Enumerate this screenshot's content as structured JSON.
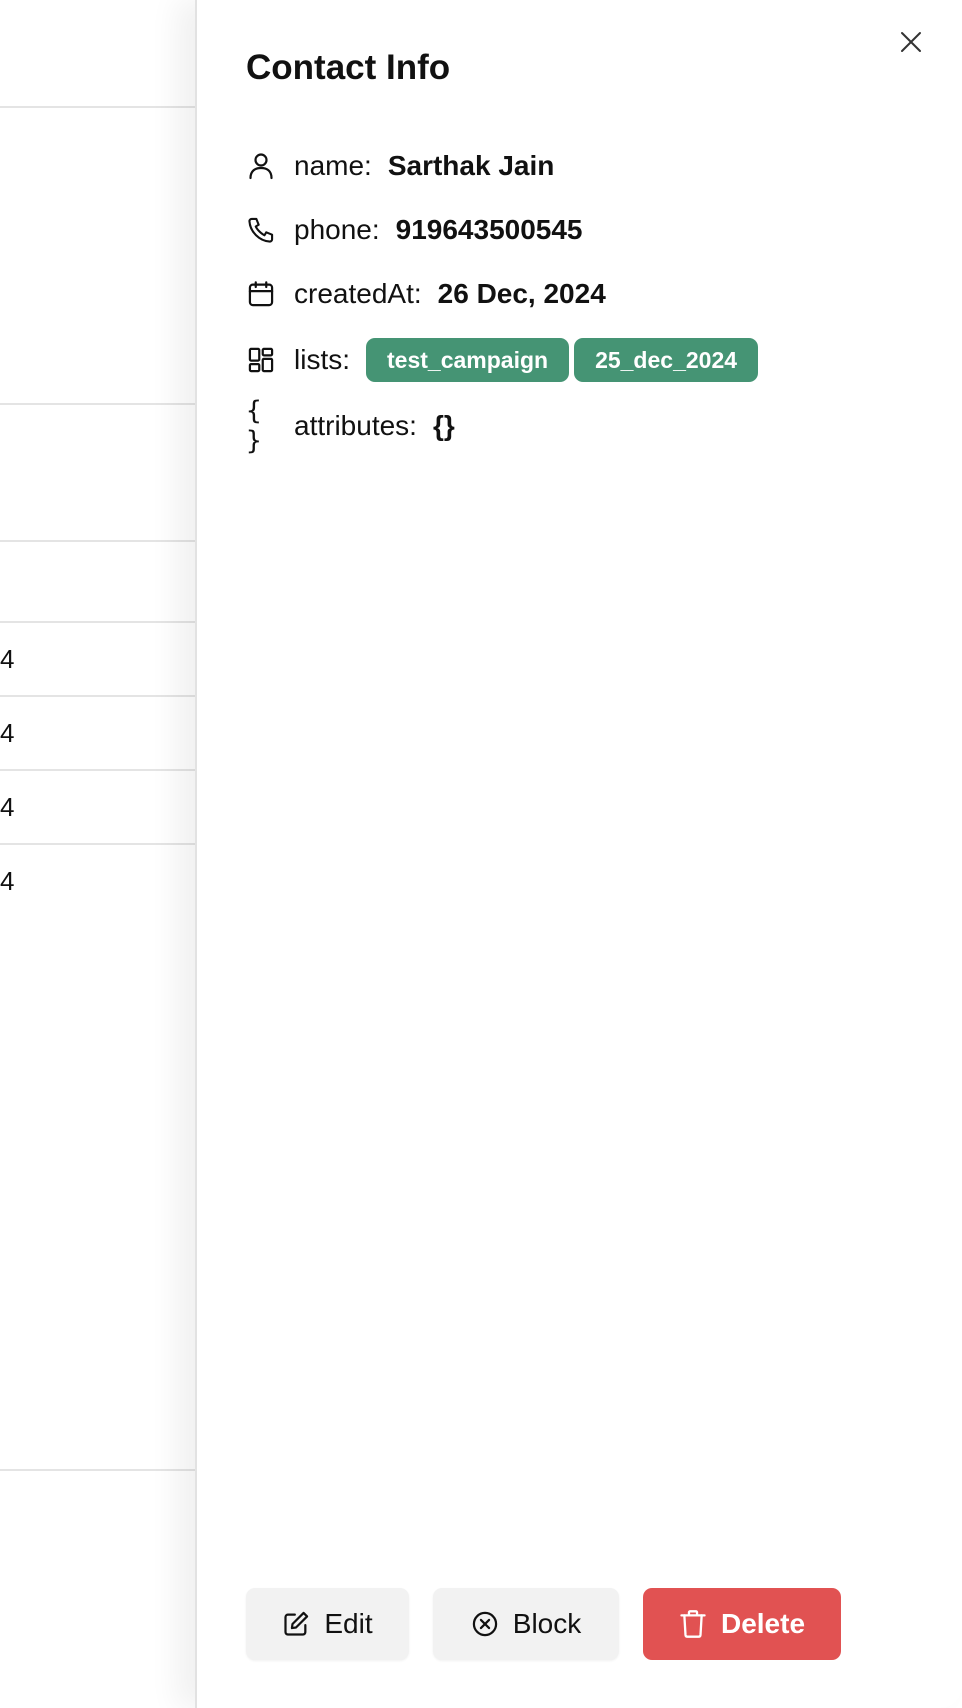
{
  "background": {
    "row_values": [
      "4",
      "4",
      "4",
      "4"
    ]
  },
  "drawer": {
    "title": "Contact Info",
    "fields": {
      "name": {
        "label": "name:",
        "value": "Sarthak Jain"
      },
      "phone": {
        "label": "phone:",
        "value": "919643500545"
      },
      "created_at": {
        "label": "createdAt:",
        "value": "26 Dec, 2024"
      },
      "lists": {
        "label": "lists:",
        "tags": [
          "test_campaign",
          "25_dec_2024"
        ]
      },
      "attributes": {
        "label": "attributes:",
        "value": "{}"
      }
    },
    "icons": {
      "braces": "{ }"
    },
    "actions": {
      "edit_label": "Edit",
      "block_label": "Block",
      "delete_label": "Delete"
    },
    "colors": {
      "tag": "#459474",
      "delete": "#e15252",
      "secondary_button": "#f2f2f2"
    }
  }
}
